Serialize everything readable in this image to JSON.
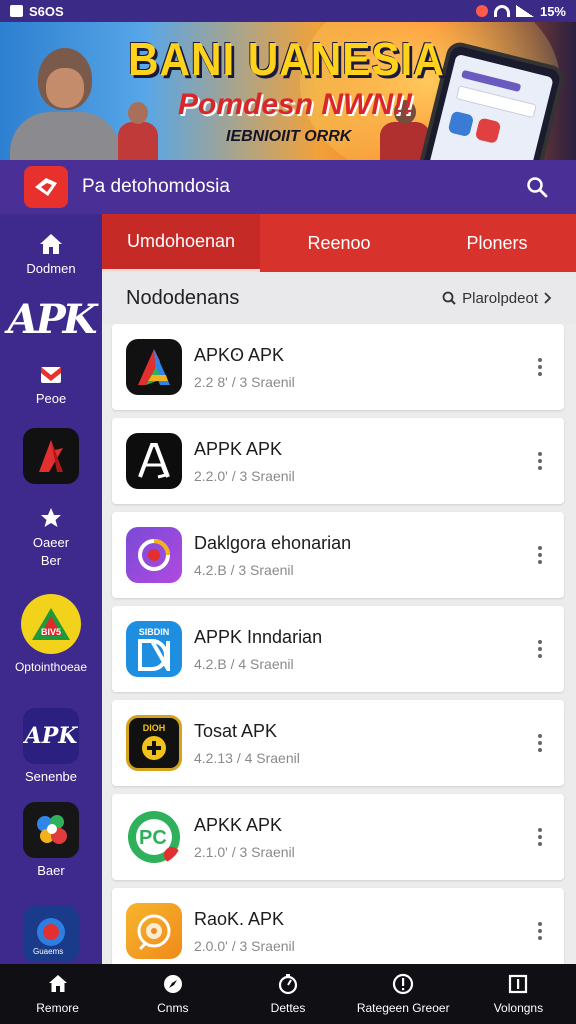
{
  "status_bar": {
    "left_text": "S6OS",
    "battery": "15%"
  },
  "banner": {
    "title": "BANI UANESIA",
    "subtitle": "Pomdesn NWN!!",
    "tagline": "IEBNIOIIT ORRK"
  },
  "app_header": {
    "app_name": "Pa detohomdosia",
    "search_icon": "search-icon"
  },
  "sidebar": {
    "items": [
      {
        "label": "Dodmen",
        "icon": "home-icon"
      },
      {
        "label": "",
        "icon": "apk-logo-icon",
        "text": "APK"
      },
      {
        "label": "Peoe",
        "icon": "flag-icon"
      },
      {
        "label": "",
        "icon": "arrow-app-icon"
      },
      {
        "label": "Oaeer\nBer",
        "icon": "star-icon"
      },
      {
        "label": "Optointhoeae",
        "icon": "triangle-logo-icon",
        "text": "BIV5"
      },
      {
        "label": "Senenbe",
        "icon": "apk-badge-icon",
        "text": "APK"
      },
      {
        "label": "Baer",
        "icon": "flower-app-icon"
      },
      {
        "label": "",
        "icon": "music-app-icon",
        "text": "Guaems"
      }
    ]
  },
  "tabs": [
    {
      "label": "Umdohoenan",
      "active": true
    },
    {
      "label": "Reenoo",
      "active": false
    },
    {
      "label": "Ploners",
      "active": false
    }
  ],
  "list_header": {
    "title": "Nododenans",
    "sort_label": "Plarolpdeot"
  },
  "apps": [
    {
      "name": "APKʘ APK",
      "meta": "2.2 8' / 3 Sraenil",
      "icon": "colorful-a-icon"
    },
    {
      "name": "APPK APK",
      "meta": "2.2.0' / 3 Sraenil",
      "icon": "outline-a-icon"
    },
    {
      "name": "Daklgora ehonarian",
      "meta": "4.2.B / 3 Sraenil",
      "icon": "circle-logo-icon"
    },
    {
      "name": "APPK Inndarian",
      "meta": "4.2.B / 4 Sraenil",
      "icon": "blue-d-icon",
      "icon_text": "SIBDIN"
    },
    {
      "name": "Tosat APK",
      "meta": "4.2.13 / 4 Sraenil",
      "icon": "gold-badge-icon",
      "icon_text": "DIOH"
    },
    {
      "name": "APKK APK",
      "meta": "2.1.0' / 3 Sraenil",
      "icon": "green-pc-icon",
      "icon_text": "PC"
    },
    {
      "name": "RaoK. APK",
      "meta": "2.0.0' / 3 Sraenil",
      "icon": "orange-disc-icon"
    }
  ],
  "bottom_nav": [
    {
      "label": "Remore",
      "icon": "home-icon"
    },
    {
      "label": "Cnms",
      "icon": "compass-icon"
    },
    {
      "label": "Dettes",
      "icon": "clock-icon"
    },
    {
      "label": "Rategeen Greoer",
      "icon": "info-circle-icon"
    },
    {
      "label": "Volongns",
      "icon": "square-icon"
    }
  ],
  "colors": {
    "primary_purple": "#4a2f96",
    "sidebar_purple": "#3e2a8c",
    "tab_red": "#d8322c",
    "nav_black": "#0f0f14"
  }
}
